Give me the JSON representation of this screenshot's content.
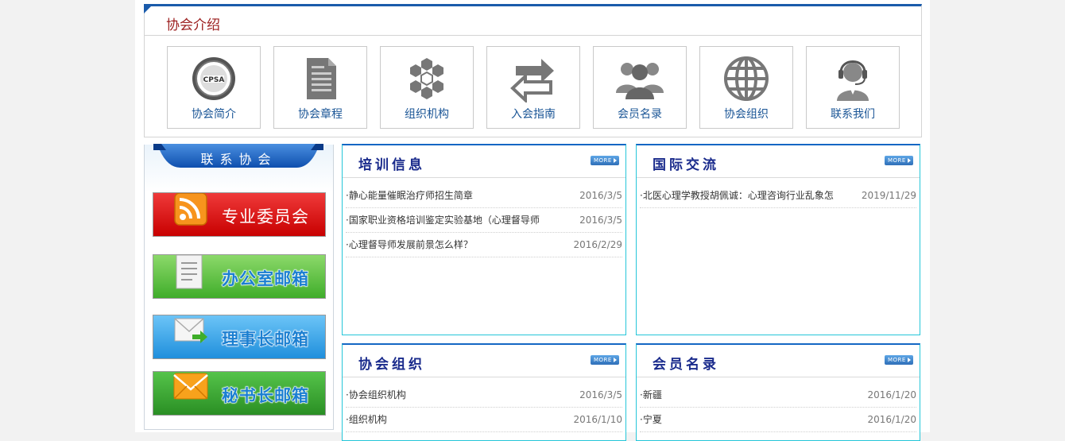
{
  "intro": {
    "title": "协会介绍",
    "tiles": [
      {
        "label": "协会简介",
        "icon": "association-seal-icon"
      },
      {
        "label": "协会章程",
        "icon": "document-icon"
      },
      {
        "label": "组织机构",
        "icon": "hexagon-network-icon"
      },
      {
        "label": "入会指南",
        "icon": "arrow-exchange-icon"
      },
      {
        "label": "会员名录",
        "icon": "people-group-icon"
      },
      {
        "label": "协会组织",
        "icon": "globe-icon"
      },
      {
        "label": "联系我们",
        "icon": "headset-support-icon"
      }
    ],
    "seal_text": "CPSA"
  },
  "contact": {
    "title": "联系协会",
    "buttons": [
      {
        "label": "专业委员会",
        "icon": "rss-icon"
      },
      {
        "label": "办公室邮箱",
        "icon": "notepad-icon"
      },
      {
        "label": "理事长邮箱",
        "icon": "mail-forward-icon"
      },
      {
        "label": "秘书长邮箱",
        "icon": "envelope-icon"
      }
    ]
  },
  "more_label": "MORE",
  "panels": [
    {
      "title": "培训信息",
      "items": [
        {
          "title": "·静心能量催眠治疗师招生简章",
          "date": "2016/3/5"
        },
        {
          "title": "·国家职业资格培训鉴定实验基地（心理督导师",
          "date": "2016/3/5"
        },
        {
          "title": "·心理督导师发展前景怎么样？",
          "date": "2016/2/29"
        }
      ]
    },
    {
      "title": "国际交流",
      "items": [
        {
          "title": "·北医心理学教授胡佩诚：心理咨询行业乱象怎",
          "date": "2019/11/29"
        }
      ]
    },
    {
      "title": "协会组织",
      "items": [
        {
          "title": "·协会组织机构",
          "date": "2016/3/5"
        },
        {
          "title": "·组织机构",
          "date": "2016/1/10"
        }
      ]
    },
    {
      "title": "会员名录",
      "items": [
        {
          "title": "·新疆",
          "date": "2016/1/20"
        },
        {
          "title": "·宁夏",
          "date": "2016/1/20"
        }
      ]
    }
  ]
}
